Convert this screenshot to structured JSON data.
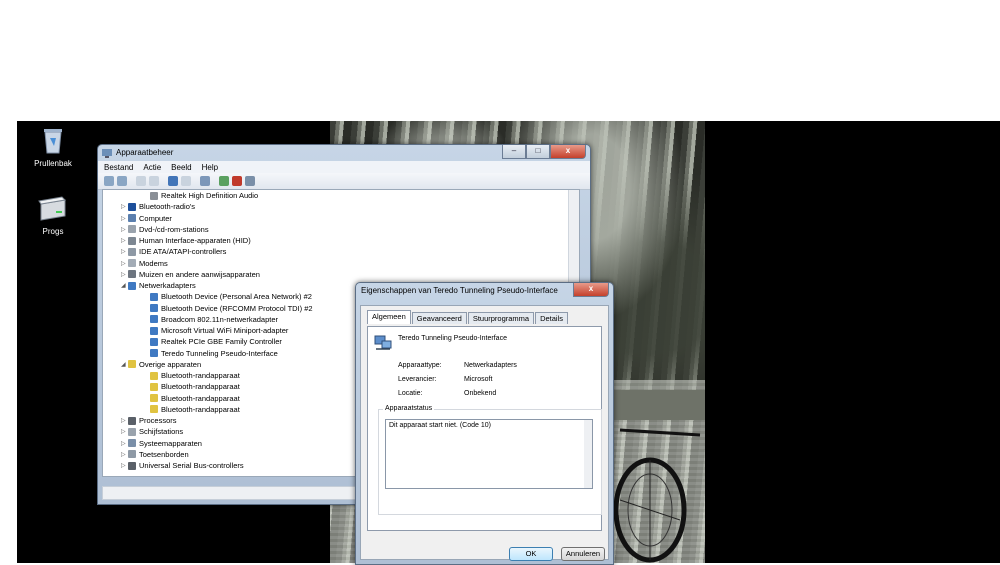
{
  "desktop": {
    "icons": [
      {
        "label": "Prullenbak",
        "icon": "recycle-bin-icon"
      },
      {
        "label": "Progs",
        "icon": "drive-icon"
      }
    ]
  },
  "device_manager": {
    "title": "Apparaatbeheer",
    "controls": {
      "minimize": "–",
      "maximize": "□",
      "close": "x"
    },
    "menu": [
      "Bestand",
      "Actie",
      "Beeld",
      "Help"
    ],
    "tree": [
      {
        "label": "Realtek High Definition Audio",
        "level": 2,
        "icon": "speaker-icon"
      },
      {
        "label": "Bluetooth-radio's",
        "level": 1,
        "icon": "bluetooth-icon"
      },
      {
        "label": "Computer",
        "level": 1,
        "icon": "computer-icon"
      },
      {
        "label": "Dvd-/cd-rom-stations",
        "level": 1,
        "icon": "dvd-icon"
      },
      {
        "label": "Human Interface-apparaten (HID)",
        "level": 1,
        "icon": "hid-icon"
      },
      {
        "label": "IDE ATA/ATAPI-controllers",
        "level": 1,
        "icon": "ide-icon"
      },
      {
        "label": "Modems",
        "level": 1,
        "icon": "modem-icon"
      },
      {
        "label": "Muizen en andere aanwijsapparaten",
        "level": 1,
        "icon": "mouse-icon"
      },
      {
        "label": "Netwerkadapters",
        "level": 1,
        "icon": "network-icon",
        "expanded": true
      },
      {
        "label": "Bluetooth Device (Personal Area Network) #2",
        "level": 2,
        "icon": "network-adapter-icon"
      },
      {
        "label": "Bluetooth Device (RFCOMM Protocol TDI) #2",
        "level": 2,
        "icon": "network-adapter-icon"
      },
      {
        "label": "Broadcom 802.11n-netwerkadapter",
        "level": 2,
        "icon": "network-adapter-icon"
      },
      {
        "label": "Microsoft Virtual WiFi Miniport-adapter",
        "level": 2,
        "icon": "network-adapter-icon"
      },
      {
        "label": "Realtek PCIe GBE Family Controller",
        "level": 2,
        "icon": "network-adapter-icon"
      },
      {
        "label": "Teredo Tunneling Pseudo-Interface",
        "level": 2,
        "icon": "network-adapter-warning-icon"
      },
      {
        "label": "Overige apparaten",
        "level": 1,
        "icon": "unknown-device-icon",
        "expanded": true
      },
      {
        "label": "Bluetooth-randapparaat",
        "level": 2,
        "icon": "warning-device-icon"
      },
      {
        "label": "Bluetooth-randapparaat",
        "level": 2,
        "icon": "warning-device-icon"
      },
      {
        "label": "Bluetooth-randapparaat",
        "level": 2,
        "icon": "warning-device-icon"
      },
      {
        "label": "Bluetooth-randapparaat",
        "level": 2,
        "icon": "warning-device-icon"
      },
      {
        "label": "Processors",
        "level": 1,
        "icon": "processor-icon"
      },
      {
        "label": "Schijfstations",
        "level": 1,
        "icon": "disk-icon"
      },
      {
        "label": "Systeemapparaten",
        "level": 1,
        "icon": "system-icon"
      },
      {
        "label": "Toetsenborden",
        "level": 1,
        "icon": "keyboard-icon"
      },
      {
        "label": "Universal Serial Bus-controllers",
        "level": 1,
        "icon": "usb-icon"
      }
    ]
  },
  "properties_dialog": {
    "title": "Eigenschappen van Teredo Tunneling Pseudo-Interface",
    "close": "x",
    "tabs": [
      "Algemeen",
      "Geavanceerd",
      "Stuurprogramma",
      "Details"
    ],
    "active_tab": "Algemeen",
    "device_name": "Teredo Tunneling Pseudo-Interface",
    "properties": [
      {
        "label": "Apparaattype:",
        "value": "Netwerkadapters"
      },
      {
        "label": "Leverancier:",
        "value": "Microsoft"
      },
      {
        "label": "Locatie:",
        "value": "Onbekend"
      }
    ],
    "status_group_label": "Apparaatstatus",
    "status_text": "Dit apparaat start niet. (Code 10)",
    "ok_label": "OK",
    "cancel_label": "Annuleren"
  }
}
